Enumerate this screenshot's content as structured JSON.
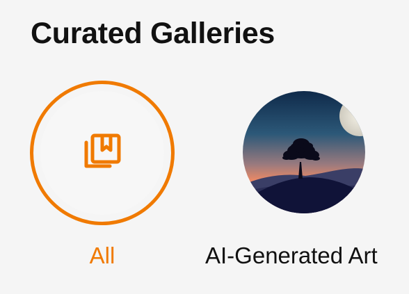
{
  "section": {
    "title": "Curated Galleries"
  },
  "galleries": [
    {
      "label": "All",
      "icon": "gallery-collection-icon",
      "selected": true
    },
    {
      "label": "AI-Generated Art",
      "icon": "tree-moon-landscape-thumbnail",
      "selected": false
    }
  ],
  "colors": {
    "accent": "#f07a00",
    "title": "#111111",
    "background": "#f5f5f5"
  }
}
